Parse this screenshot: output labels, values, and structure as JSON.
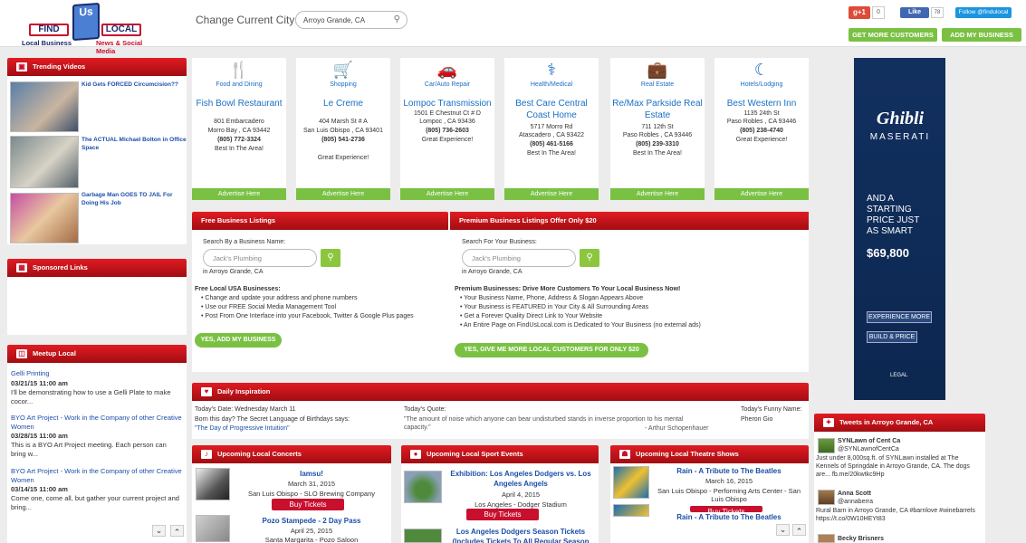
{
  "header": {
    "logo": {
      "find": "FIND",
      "us": "Us",
      "local": "LOCAL",
      "tag_left": "Local Business",
      "tag_right": "News & Social Media"
    },
    "city_label": "Change Current City:",
    "city_value": "Arroyo Grande, CA",
    "gplus_label": "g+1",
    "gplus_count": "0",
    "fb_like": "Like",
    "fb_count": "78",
    "twitter_follow": "Follow @findulocal",
    "get_more_customers": "GET MORE CUSTOMERS",
    "add_my_business": "ADD MY BUSINESS"
  },
  "trending": {
    "title": "Trending Videos",
    "items": [
      {
        "title": "Kid Gets FORCED Circumcision??"
      },
      {
        "title": "The ACTUAL Michael Bolton in Office Space"
      },
      {
        "title": "Garbage Man GOES TO JAIL For Doing His Job"
      }
    ]
  },
  "sponsored": {
    "title": "Sponsored Links"
  },
  "meetup": {
    "title": "Meetup Local",
    "items": [
      {
        "title": "Gelli Printing",
        "date": "03/21/15 11:00 am",
        "desc": "I'll be demonstrating how to use a Gelli Plate to make cocor..."
      },
      {
        "title": "BYO Art Project - Work in the Company of other Creative Women",
        "date": "03/28/15 11:00 am",
        "desc": "This is a BYO Art Project meeting. Each person can bring w..."
      },
      {
        "title": "BYO Art Project - Work in the Company of other Creative Women",
        "date": "03/14/15 11:00 am",
        "desc": "Come one, come all, but gather your current project and bring..."
      }
    ]
  },
  "cards": [
    {
      "category": "Food and Dining",
      "icon": "utensils-icon",
      "glyph": "🍴",
      "name": "Fish Bowl Restaurant",
      "lines": [
        "801 Embarcadero",
        "Morro Bay , CA 93442",
        "(805) 772-3324",
        "Best In The Area!"
      ],
      "advertise": "Advertise Here"
    },
    {
      "category": "Shopping",
      "icon": "cart-icon",
      "glyph": "🛒",
      "name": "Le Creme",
      "lines": [
        "404 Marsh St # A",
        "San Luis Obispo , CA 93401",
        "(805) 541-2736",
        "",
        "Great Experience!"
      ],
      "advertise": "Advertise Here"
    },
    {
      "category": "Car/Auto Repair",
      "icon": "car-icon",
      "glyph": "🚗",
      "name": "Lompoc Transmission",
      "lines": [
        "1501 E Chestnut Ct # D",
        "Lompoc , CA 93436",
        "(805) 736-2603",
        "Great Experience!"
      ],
      "advertise": "Advertise Here"
    },
    {
      "category": "Health/Medical",
      "icon": "stethoscope-icon",
      "glyph": "⚕",
      "name": "Best Care Central Coast Home",
      "lines": [
        "5717 Morro Rd",
        "Atascadero , CA 93422",
        "(805) 461-5166",
        "Best In The Area!"
      ],
      "advertise": "Advertise Here"
    },
    {
      "category": "Real Estate",
      "icon": "briefcase-icon",
      "glyph": "💼",
      "name": "Re/Max Parkside Real Estate",
      "lines": [
        "711 12th St",
        "Paso Robles , CA 93446",
        "(805) 239-3310",
        "Best In The Area!"
      ],
      "advertise": "Advertise Here"
    },
    {
      "category": "Hotels/Lodging",
      "icon": "moon-icon",
      "glyph": "☾",
      "name": "Best Western Inn",
      "lines": [
        "1135 24th St",
        "Paso Robles , CA 93446",
        "(805) 238-4740",
        "Great Experience!"
      ],
      "advertise": "Advertise Here"
    }
  ],
  "free_listing": {
    "title": "Free Business Listings",
    "search_label": "Search By a Business Name:",
    "placeholder": "Jack's Plumbing",
    "in_city": "in Arroyo Grande, CA",
    "heading": "Free Local USA Businesses:",
    "bullets": [
      "Change and update your address and phone numbers",
      "Use our FREE Social Media Management Tool",
      "Post From One Interface into your Facebook, Twitter & Google Plus pages"
    ],
    "cta": "YES, ADD MY BUSINESS"
  },
  "premium_listing": {
    "title": "Premium Business Listings Offer Only $20",
    "search_label": "Search For Your Business:",
    "placeholder": "Jack's Plumbing",
    "in_city": "in Arroyo Grande, CA",
    "heading": "Premium Businesses: Drive More Customers To Your Local Business Now!",
    "bullets": [
      "Your Business Name, Phone, Address & Slogan Appears Above",
      "Your Business is FEATURED in Your City & All Surrounding Areas",
      "Get a Forever Quality Direct Link to Your Website",
      "An Entire Page on FindUsLocal.com is Dedicated to Your Business (no external ads)"
    ],
    "cta": "YES, GIVE ME MORE LOCAL CUSTOMERS FOR ONLY $20"
  },
  "inspiration": {
    "title": "Daily Inspiration",
    "date_label": "Today's Date: Wednesday March 11",
    "birthday_line": "Born this day? The Secret Language of Birthdays says:",
    "birthday_value": "\"The Day of Progressive Intuition\"",
    "quote_label": "Today's Quote:",
    "quote": "\"The amount of noise which anyone can bear undisturbed stands in inverse proportion to his mental capacity.\"",
    "quote_author": "- Arthur Schopenhauer",
    "funny_label": "Today's Funny Name:",
    "funny_name": "Pheron Gio"
  },
  "concerts": {
    "title": "Upcoming Local Concerts",
    "events": [
      {
        "title": "Iamsu!",
        "date": "March 31, 2015",
        "venue": "San Luis Obispo - SLO Brewing Company",
        "buy": "Buy Tickets"
      },
      {
        "title": "Pozo Stampede - 2 Day Pass",
        "date": "April 25, 2015",
        "venue": "Santa Margarita - Pozo Saloon"
      }
    ]
  },
  "sports": {
    "title": "Upcoming Local Sport Events",
    "events": [
      {
        "title": "Exhibition: Los Angeles Dodgers vs. Los Angeles Angels",
        "date": "April 4, 2015",
        "venue": "Los Angeles - Dodger Stadium",
        "buy": "Buy Tickets"
      },
      {
        "title": "Los Angeles Dodgers Season Tickets (Includes Tickets To All Regular Season"
      }
    ]
  },
  "theatre": {
    "title": "Upcoming Local Theatre Shows",
    "events": [
      {
        "title": "Rain - A Tribute to The Beatles",
        "date": "March 16, 2015",
        "venue": "San Luis Obispo - Performing Arts Center - San Luis Obispo",
        "buy": "Buy Tickets"
      },
      {
        "title": "Rain - A Tribute to The Beatles"
      }
    ]
  },
  "ad": {
    "brand": "Ghibli",
    "maker": "MASERATI",
    "line1": "AND A",
    "line2": "STARTING",
    "line3": "PRICE JUST",
    "line4": "AS SMART",
    "price": "$69,800",
    "btn1": "EXPERIENCE MORE",
    "btn2": "BUILD & PRICE",
    "legal": "LEGAL"
  },
  "tweets": {
    "title": "Tweets in Arroyo Grande, CA",
    "items": [
      {
        "name": "SYNLawn of Cent Ca",
        "handle": "@SYNLawnofCentCa",
        "text": "Just under 8,000sq.ft. of SYNLawn installed at The Kennels of Springdale in Arroyo Grande, CA. The dogs are... fb.me/20kwtkc9Hp"
      },
      {
        "name": "Anna Scott",
        "handle": "@annaberra",
        "text": "Rural Barn in Arroyo Grande, CA #barnlove #winebarrels https://t.co/0W10HEYt83"
      },
      {
        "name": "Becky Brisners",
        "handle": "",
        "text": ""
      }
    ]
  },
  "scroll": {
    "down": "⌄",
    "up": "⌃"
  }
}
